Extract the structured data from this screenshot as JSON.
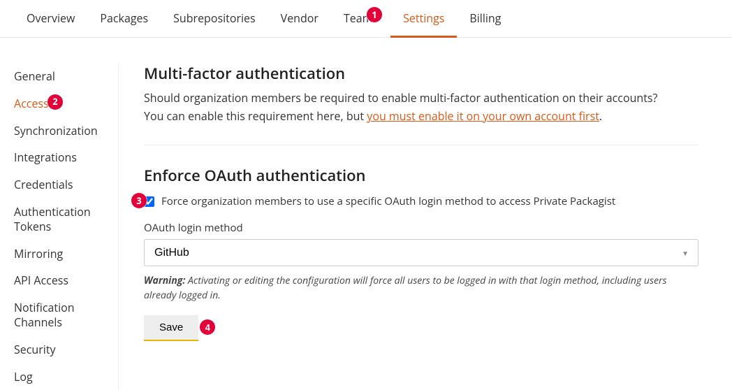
{
  "topnav": {
    "items": [
      {
        "label": "Overview"
      },
      {
        "label": "Packages"
      },
      {
        "label": "Subrepositories"
      },
      {
        "label": "Vendor"
      },
      {
        "label": "Teams"
      },
      {
        "label": "Settings"
      },
      {
        "label": "Billing"
      }
    ]
  },
  "sidebar": {
    "items": [
      {
        "label": "General"
      },
      {
        "label": "Access"
      },
      {
        "label": "Synchronization"
      },
      {
        "label": "Integrations"
      },
      {
        "label": "Credentials"
      },
      {
        "label": "Authentication Tokens"
      },
      {
        "label": "Mirroring"
      },
      {
        "label": "API Access"
      },
      {
        "label": "Notification Channels"
      },
      {
        "label": "Security"
      },
      {
        "label": "Log"
      }
    ]
  },
  "mfa": {
    "heading": "Multi-factor authentication",
    "desc_line1": "Should organization members be required to enable multi-factor authentication on their accounts?",
    "desc_line2_prefix": "You can enable this requirement here, but ",
    "desc_line2_link": "you must enable it on your own account first",
    "desc_line2_suffix": "."
  },
  "oauth": {
    "heading": "Enforce OAuth authentication",
    "checkbox_label": "Force organization members to use a specific OAuth login method to access Private Packagist",
    "method_label": "OAuth login method",
    "selected_method": "GitHub",
    "warning_label": "Warning:",
    "warning_text": " Activating or editing the configuration will force all users to be logged in with that login method, including users already logged in.",
    "save_label": "Save"
  },
  "callouts": {
    "one": "1",
    "two": "2",
    "three": "3",
    "four": "4"
  }
}
